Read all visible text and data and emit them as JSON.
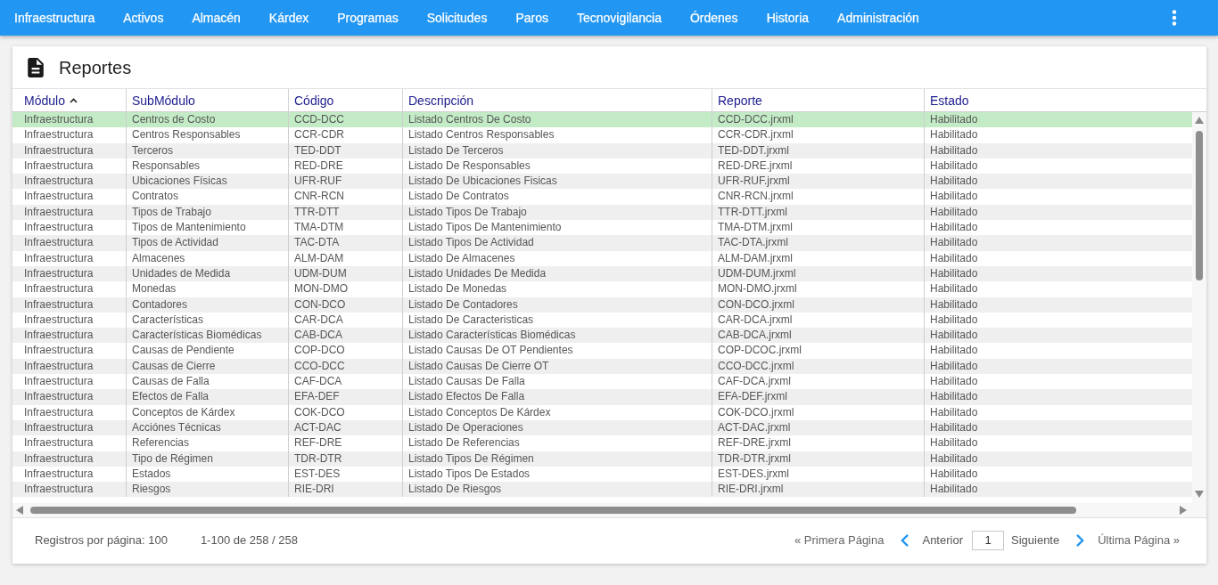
{
  "nav": {
    "items": [
      "Infraestructura",
      "Activos",
      "Almacén",
      "Kárdex",
      "Programas",
      "Solicitudes",
      "Paros",
      "Tecnovigilancia",
      "Órdenes",
      "Historia",
      "Administración"
    ]
  },
  "page": {
    "title": "Reportes"
  },
  "table": {
    "columns": [
      {
        "label": "Módulo",
        "sorted": true
      },
      {
        "label": "SubMódulo",
        "sorted": false
      },
      {
        "label": "Código",
        "sorted": false
      },
      {
        "label": "Descripción",
        "sorted": false
      },
      {
        "label": "Reporte",
        "sorted": false
      },
      {
        "label": "Estado",
        "sorted": false
      }
    ],
    "rows": [
      {
        "selected": true,
        "cells": [
          "Infraestructura",
          "Centros de Costo",
          "CCD-DCC",
          "Listado Centros De Costo",
          "CCD-DCC.jrxml",
          "Habilitado"
        ]
      },
      {
        "selected": false,
        "cells": [
          "Infraestructura",
          "Centros Responsables",
          "CCR-CDR",
          "Listado Centros Responsables",
          "CCR-CDR.jrxml",
          "Habilitado"
        ]
      },
      {
        "selected": false,
        "cells": [
          "Infraestructura",
          "Terceros",
          "TED-DDT",
          "Listado De Terceros",
          "TED-DDT.jrxml",
          "Habilitado"
        ]
      },
      {
        "selected": false,
        "cells": [
          "Infraestructura",
          "Responsables",
          "RED-DRE",
          "Listado De Responsables",
          "RED-DRE.jrxml",
          "Habilitado"
        ]
      },
      {
        "selected": false,
        "cells": [
          "Infraestructura",
          "Ubicaciones Físicas",
          "UFR-RUF",
          "Listado De Ubicaciones Fisicas",
          "UFR-RUF.jrxml",
          "Habilitado"
        ]
      },
      {
        "selected": false,
        "cells": [
          "Infraestructura",
          "Contratos",
          "CNR-RCN",
          "Listado De Contratos",
          "CNR-RCN.jrxml",
          "Habilitado"
        ]
      },
      {
        "selected": false,
        "cells": [
          "Infraestructura",
          "Tipos de Trabajo",
          "TTR-DTT",
          "Listado Tipos De Trabajo",
          "TTR-DTT.jrxml",
          "Habilitado"
        ]
      },
      {
        "selected": false,
        "cells": [
          "Infraestructura",
          "Tipos de Mantenimiento",
          "TMA-DTM",
          "Listado Tipos De Mantenimiento",
          "TMA-DTM.jrxml",
          "Habilitado"
        ]
      },
      {
        "selected": false,
        "cells": [
          "Infraestructura",
          "Tipos de Actividad",
          "TAC-DTA",
          "Listado Tipos De Actividad",
          "TAC-DTA.jrxml",
          "Habilitado"
        ]
      },
      {
        "selected": false,
        "cells": [
          "Infraestructura",
          "Almacenes",
          "ALM-DAM",
          "Listado De Almacenes",
          "ALM-DAM.jrxml",
          "Habilitado"
        ]
      },
      {
        "selected": false,
        "cells": [
          "Infraestructura",
          "Unidades de Medida",
          "UDM-DUM",
          "Listado Unidades De Medida",
          "UDM-DUM.jrxml",
          "Habilitado"
        ]
      },
      {
        "selected": false,
        "cells": [
          "Infraestructura",
          "Monedas",
          "MON-DMO",
          "Listado De Monedas",
          "MON-DMO.jrxml",
          "Habilitado"
        ]
      },
      {
        "selected": false,
        "cells": [
          "Infraestructura",
          "Contadores",
          "CON-DCO",
          "Listado De Contadores",
          "CON-DCO.jrxml",
          "Habilitado"
        ]
      },
      {
        "selected": false,
        "cells": [
          "Infraestructura",
          "Características",
          "CAR-DCA",
          "Listado De Caracteristicas",
          "CAR-DCA.jrxml",
          "Habilitado"
        ]
      },
      {
        "selected": false,
        "cells": [
          "Infraestructura",
          "Características Biomédicas",
          "CAB-DCA",
          "Listado Características Biomédicas",
          "CAB-DCA.jrxml",
          "Habilitado"
        ]
      },
      {
        "selected": false,
        "cells": [
          "Infraestructura",
          "Causas de Pendiente",
          "COP-DCO",
          "Listado Causas De OT Pendientes",
          "COP-DCOC.jrxml",
          "Habilitado"
        ]
      },
      {
        "selected": false,
        "cells": [
          "Infraestructura",
          "Causas de Cierre",
          "CCO-DCC",
          "Listado Causas De Cierre OT",
          "CCO-DCC.jrxml",
          "Habilitado"
        ]
      },
      {
        "selected": false,
        "cells": [
          "Infraestructura",
          "Causas de Falla",
          "CAF-DCA",
          "Listado Causas De Falla",
          "CAF-DCA.jrxml",
          "Habilitado"
        ]
      },
      {
        "selected": false,
        "cells": [
          "Infraestructura",
          "Efectos de Falla",
          "EFA-DEF",
          "Listado Efectos De Falla",
          "EFA-DEF.jrxml",
          "Habilitado"
        ]
      },
      {
        "selected": false,
        "cells": [
          "Infraestructura",
          "Conceptos de Kárdex",
          "COK-DCO",
          "Listado Conceptos De Kárdex",
          "COK-DCO.jrxml",
          "Habilitado"
        ]
      },
      {
        "selected": false,
        "cells": [
          "Infraestructura",
          "Acciónes Técnicas",
          "ACT-DAC",
          "Listado De Operaciones",
          "ACT-DAC.jrxml",
          "Habilitado"
        ]
      },
      {
        "selected": false,
        "cells": [
          "Infraestructura",
          "Referencias",
          "REF-DRE",
          "Listado De Referencias",
          "REF-DRE.jrxml",
          "Habilitado"
        ]
      },
      {
        "selected": false,
        "cells": [
          "Infraestructura",
          "Tipo de Régimen",
          "TDR-DTR",
          "Listado Tipos De Régimen",
          "TDR-DTR.jrxml",
          "Habilitado"
        ]
      },
      {
        "selected": false,
        "cells": [
          "Infraestructura",
          "Estados",
          "EST-DES",
          "Listado Tipos De Estados",
          "EST-DES.jrxml",
          "Habilitado"
        ]
      },
      {
        "selected": false,
        "cells": [
          "Infraestructura",
          "Riesgos",
          "RIE-DRI",
          "Listado De Riesgos",
          "RIE-DRI.jrxml",
          "Habilitado"
        ]
      }
    ]
  },
  "footer": {
    "page_size": "Registros por página: 100",
    "range": "1-100 de 258 / 258",
    "first": "« Primera Página",
    "previous": "Anterior",
    "page": "1",
    "next": "Siguiente",
    "last": "Última Página »"
  }
}
